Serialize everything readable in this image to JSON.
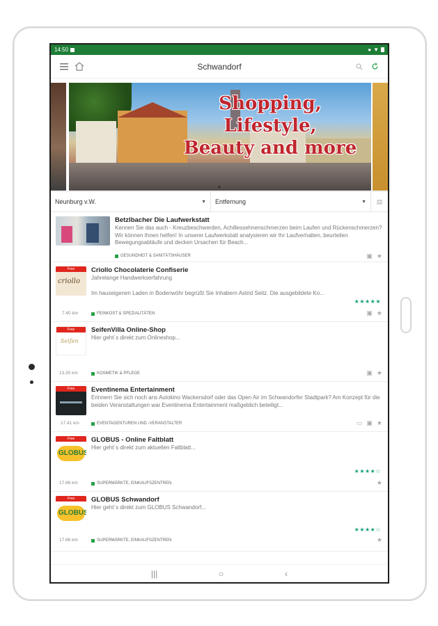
{
  "status": {
    "time": "14:50"
  },
  "appbar": {
    "title": "Schwandorf",
    "menu_icon": "menu-icon",
    "home_icon": "home-icon",
    "search_icon": "search-icon",
    "refresh_icon": "refresh-icon"
  },
  "banner": {
    "line1": "Shopping, Lifestyle,",
    "line2": "Beauty and more",
    "dots": "●"
  },
  "filters": {
    "location": "Neunburg v.W.",
    "sort": "Entfernung"
  },
  "items": [
    {
      "name": "Betzlbacher Die Laufwerkstatt",
      "desc": "Kennen Sie das auch - Kreuzbeschwerden, Achillessehnenschmerzen beim Laufen und Rückenschmerzen? Wir können Ihnen helfen! In unserer Laufwerkstatt analysieren wir Ihr Laufverhalten, beurteilen Bewegungsabläufe und decken Ursachen für Beach...",
      "category": "GESUNDHEIT & SANITÄTSHÄUSER",
      "distance": "",
      "stars": ""
    },
    {
      "name": "Criollo Chocolaterie Confiserie",
      "desc": "Jahrelange Handwerkserfahrung",
      "desc2": "Im hauseigenen Laden in Bodenwöhr begrüßt Sie Inhabern Astrid Seitz. Die ausgebildete Ko...",
      "category": "FEINKOST & SPEZIALITÄTEN",
      "distance": "7.40 km",
      "stars": "★★★★★"
    },
    {
      "name": "SeifenVilla Online-Shop",
      "desc": "Hier geht´s direkt zum Onlineshop...",
      "category": "KOSMETIK & PFLEGE",
      "distance": "13.35 km",
      "stars": ""
    },
    {
      "name": "Eventinema Entertainment",
      "desc": "Erinnern Sie sich noch ans Autokino Wackersdorf oder das Open Air im Schwandorfer Stadtpark? Am Konzept für die beiden Veranstaltungen war Eventinema Entertainment maßgeblich beteiligt...",
      "category": "EVENTAGENTUREN UND -VERANSTALTER",
      "distance": "17.41 km",
      "stars": ""
    },
    {
      "name": "GLOBUS - Online Faltblatt",
      "desc": "Hier geht´s direkt zum aktuellen Faltblatt...",
      "category": "SUPERMÄRKTE, EINKAUFSZENTREN",
      "distance": "17.86 km",
      "stars": "★★★★☆"
    },
    {
      "name": "GLOBUS Schwandorf",
      "desc": "Hier geht´s direkt zum GLOBUS Schwandorf...",
      "category": "SUPERMÄRKTE, EINKAUFSZENTREN",
      "distance": "17.86 km",
      "stars": "★★★★☆"
    }
  ],
  "thumbs": {
    "criollo": "criollo",
    "globus": "globus",
    "badge": "Free"
  },
  "colors": {
    "status_bar": "#1e7d36",
    "accent": "#27a046",
    "stars": "#15a07a"
  }
}
